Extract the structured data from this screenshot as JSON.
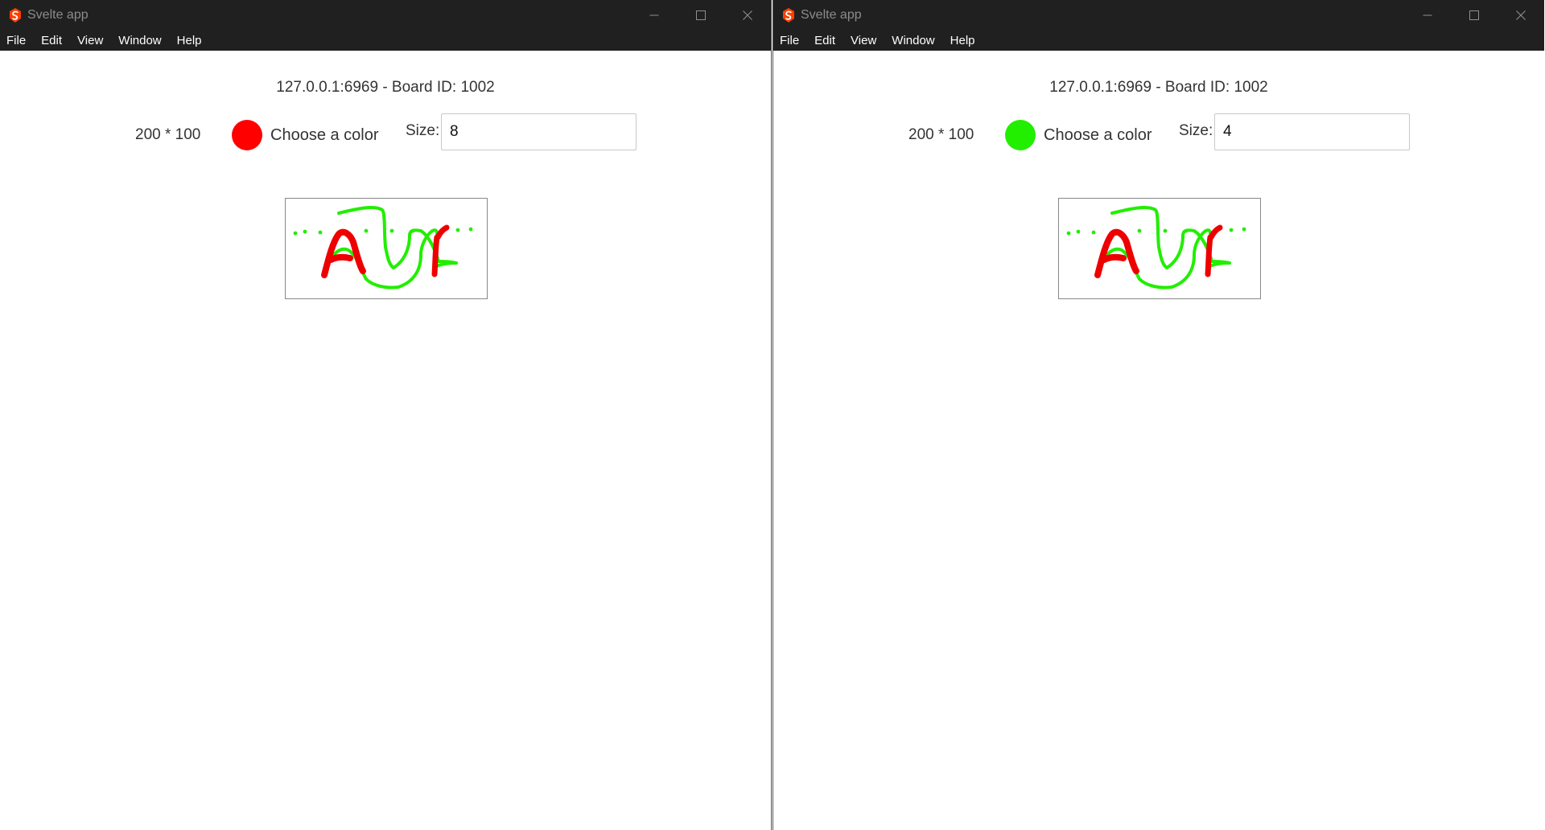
{
  "windows": [
    {
      "title": "Svelte app",
      "menu": [
        "File",
        "Edit",
        "View",
        "Window",
        "Help"
      ],
      "board_info": "127.0.0.1:6969 - Board ID: 1002",
      "dimensions": "200 * 100",
      "color_label": "Choose a color",
      "selected_color": "#ff0000",
      "size_label": "Size:",
      "size_value": "8"
    },
    {
      "title": "Svelte app",
      "menu": [
        "File",
        "Edit",
        "View",
        "Window",
        "Help"
      ],
      "board_info": "127.0.0.1:6969 - Board ID: 1002",
      "dimensions": "200 * 100",
      "color_label": "Choose a color",
      "selected_color": "#22ee00",
      "size_label": "Size:",
      "size_value": "4"
    }
  ],
  "colors": {
    "titlebar": "#202020",
    "stroke_red": "#ee0000",
    "stroke_green": "#22ee00",
    "app_icon": "#ff3e00"
  },
  "icons": {
    "app_logo": "svelte-logo-icon",
    "minimize": "minimize-icon",
    "maximize": "maximize-icon",
    "close": "close-icon"
  }
}
